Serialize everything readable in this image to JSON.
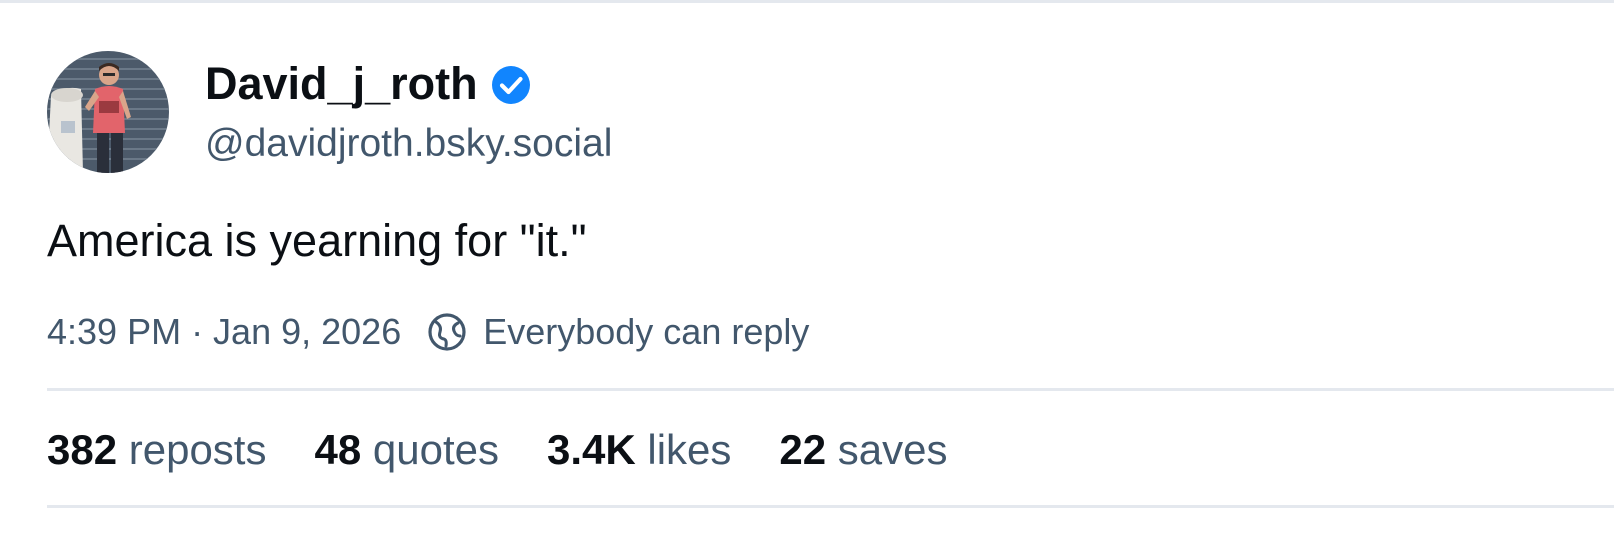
{
  "author": {
    "display_name": "David_j_roth",
    "handle": "@davidjroth.bsky.social",
    "verified_icon": "verified-badge-icon",
    "avatar_icon": "avatar-photo"
  },
  "post": {
    "text": "America is yearning for \"it.\""
  },
  "meta": {
    "timestamp": "4:39 PM · Jan 9, 2026",
    "reply_icon": "globe-icon",
    "reply_setting": "Everybody can reply"
  },
  "stats": {
    "reposts_count": "382",
    "reposts_label": "reposts",
    "quotes_count": "48",
    "quotes_label": "quotes",
    "likes_count": "3.4K",
    "likes_label": "likes",
    "saves_count": "22",
    "saves_label": "saves"
  },
  "colors": {
    "accent": "#1185fe",
    "text": "#0b0f14",
    "muted": "#42576c",
    "divider": "#e4e8ee"
  }
}
